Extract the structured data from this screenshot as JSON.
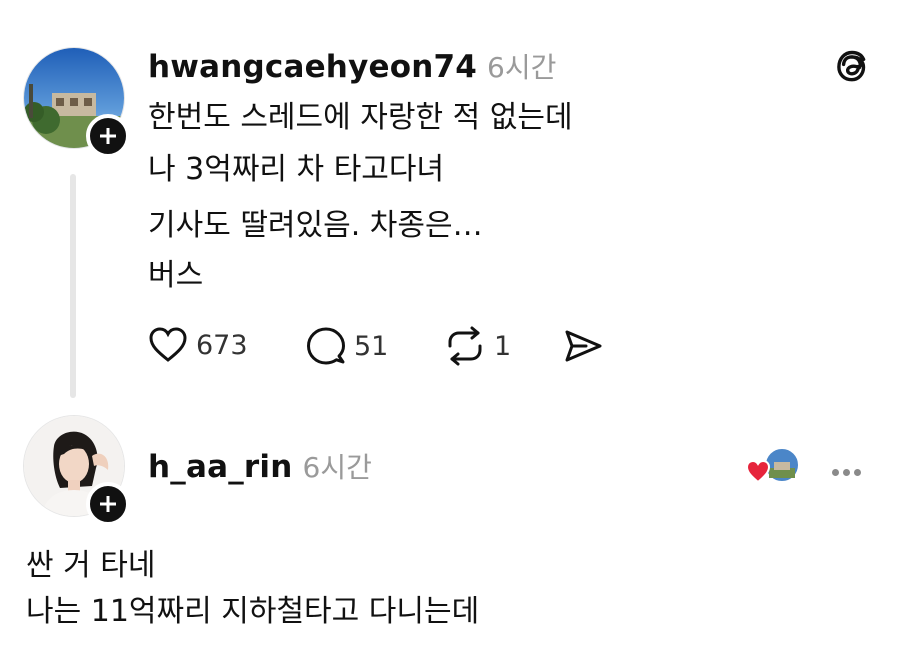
{
  "post": {
    "username": "hwangcaehyeon74",
    "time": "6시간",
    "lines": [
      "한번도 스레드에 자랑한 적 없는데",
      "나 3억짜리 차 타고다녀",
      "기사도 딸려있음. 차종은…",
      "버스"
    ],
    "likes": "673",
    "comments": "51",
    "reposts": "1",
    "app_icon": "threads-logo-icon"
  },
  "reply": {
    "username": "h_aa_rin",
    "time": "6시간",
    "lines": [
      "싼 거 타네",
      "나는 11억짜리 지하철타고 다니는데"
    ],
    "liked_by_author": true
  },
  "colors": {
    "text": "#111111",
    "muted": "#9a9a9a",
    "heart": "#e6243c",
    "line": "#e6e6e6"
  }
}
